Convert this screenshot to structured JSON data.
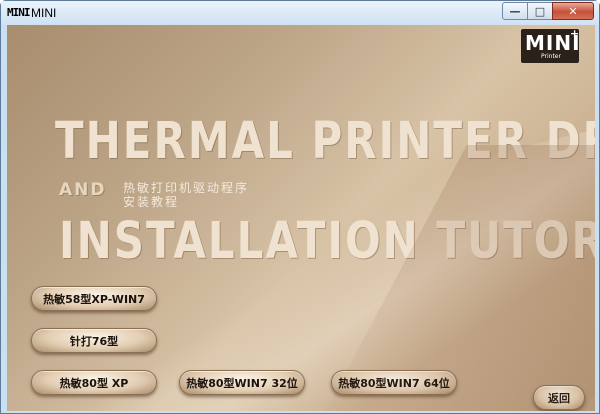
{
  "window": {
    "title": "MINI",
    "app_icon_text": "MINI",
    "controls": {
      "minimize": "—",
      "maximize": "□",
      "close": "✕"
    }
  },
  "logo": {
    "text": "MINI",
    "sub": "Printer",
    "superscript": "+"
  },
  "headline": {
    "line1": "THERMAL PRINTER DRIVERS",
    "and": "AND",
    "line2": "INSTALLATION TUTORIAL",
    "cn_line1": "热敏打印机驱动程序",
    "cn_line2": "安装教程"
  },
  "buttons": {
    "thermal58": "热敏58型XP-WIN7",
    "dot76": "针打76型",
    "thermal80xp": "热敏80型 XP",
    "thermal80w32": "热敏80型WIN7 32位",
    "thermal80w64": "热敏80型WIN7 64位",
    "back": "返回"
  }
}
